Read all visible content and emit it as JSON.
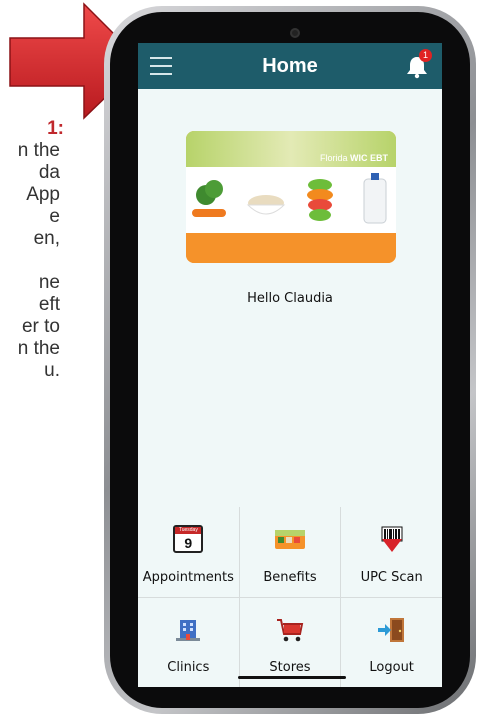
{
  "instructions": {
    "step_label": "1:",
    "lines": [
      "n the",
      "da",
      "App",
      "e",
      "en,",
      "",
      "ne",
      "eft",
      "er to",
      "n the",
      "u."
    ]
  },
  "app": {
    "header": {
      "title": "Home",
      "notification_count": "1"
    },
    "card": {
      "brand": "Florida",
      "brand_bold": "WIC EBT"
    },
    "greeting": "Hello Claudia",
    "tiles": [
      {
        "label": "Appointments",
        "icon": "calendar-icon",
        "calendar_weekday": "Tuesday",
        "calendar_day": "9"
      },
      {
        "label": "Benefits",
        "icon": "benefits-card-icon"
      },
      {
        "label": "UPC Scan",
        "icon": "barcode-scan-icon"
      },
      {
        "label": "Clinics",
        "icon": "clinic-building-icon"
      },
      {
        "label": "Stores",
        "icon": "shopping-cart-icon"
      },
      {
        "label": "Logout",
        "icon": "logout-door-icon"
      }
    ]
  },
  "colors": {
    "header": "#1e5c6a",
    "arrow": "#d3232a",
    "accent_text": "#c0282d"
  }
}
